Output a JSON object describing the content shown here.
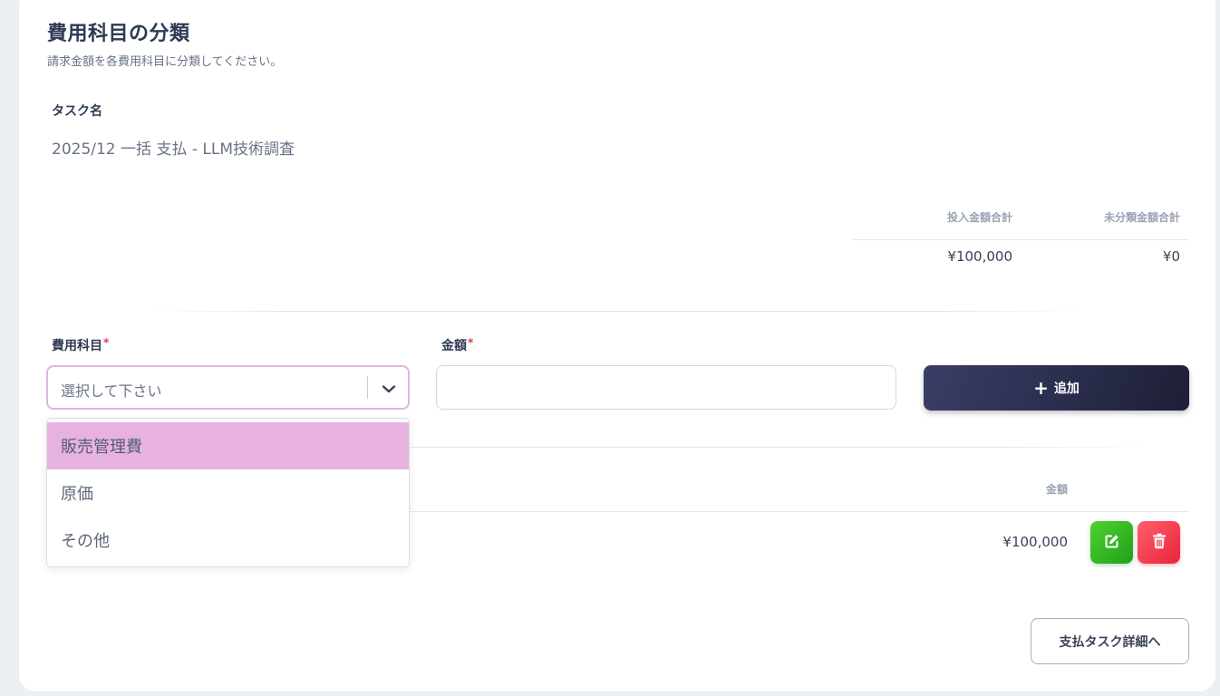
{
  "header": {
    "title": "費用科目の分類",
    "subtitle": "請求金額を各費用科目に分類してください。"
  },
  "task": {
    "label": "タスク名",
    "name": "2025/12 一括 支払 - LLM技術調査"
  },
  "summary": {
    "input_total_label": "投入金額合計",
    "unclassified_total_label": "未分類金額合計",
    "input_total_value": "¥100,000",
    "unclassified_total_value": "¥0"
  },
  "form": {
    "category_label": "費用科目",
    "amount_label": "金額",
    "required_mark": "*",
    "category_placeholder": "選択して下さい",
    "amount_value": "",
    "add_label": "追加",
    "add_icon": "plus-icon"
  },
  "dropdown": {
    "options": [
      "販売管理費",
      "原価",
      "その他"
    ],
    "highlighted_index": 0
  },
  "table": {
    "amount_header": "金額",
    "rows": [
      {
        "amount": "¥100,000"
      }
    ],
    "edit_icon": "edit-icon",
    "delete_icon": "trash-icon"
  },
  "footer": {
    "back_label": "支払タスク詳細へ"
  },
  "colors": {
    "select_focus_border": "#e4b2e0",
    "option_highlight": "#e8b2e0",
    "add_button": "#2a2d4c",
    "edit_button": "#2fb425",
    "delete_button": "#f2394c",
    "required": "#e2365b"
  }
}
